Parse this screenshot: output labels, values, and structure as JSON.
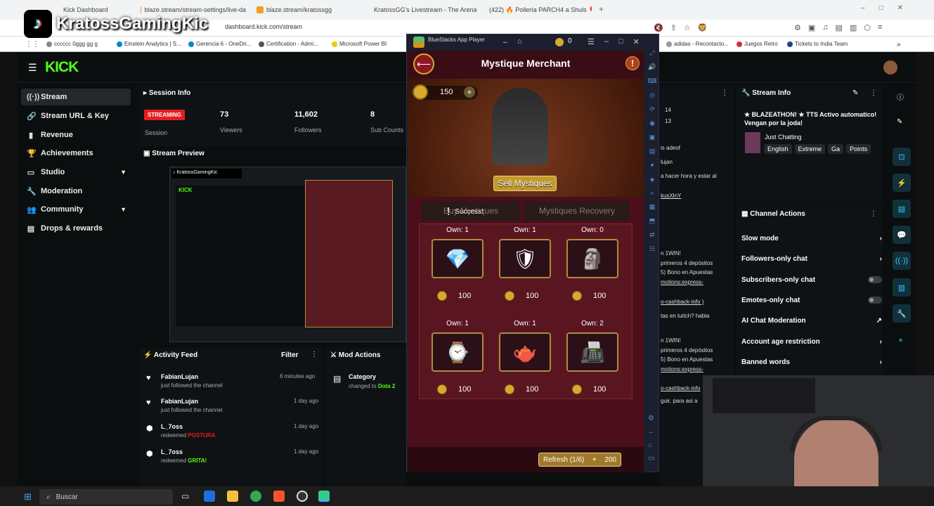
{
  "browser": {
    "tabs": [
      "Kick Dashboard",
      "blaze.stream/stream-settings/live-da",
      "blaze.stream/kratossgg",
      "KratossGG's Livestream - The Arena",
      "(422) 🔥 Pollería PARCH4 a Shuls 🎈"
    ],
    "url": "dashboard.kick.com/stream",
    "bookmarks": [
      "cccccc 0ggg gg g",
      "Einstein Analytics | S...",
      "Gerencia 6 - OneDri...",
      "Certification - Admi...",
      "Microsoft Power BI",
      "adidas - Recontacto...",
      "Juegos Retro",
      "Tickets to India Team"
    ]
  },
  "overlay": {
    "channel": "KratossGamingKic"
  },
  "sidebar": {
    "items": [
      {
        "label": "Stream",
        "icon": "broadcast-icon"
      },
      {
        "label": "Stream URL & Key",
        "icon": "link-icon"
      },
      {
        "label": "Revenue",
        "icon": "chart-icon"
      },
      {
        "label": "Achievements",
        "icon": "trophy-icon"
      },
      {
        "label": "Studio",
        "icon": "monitor-icon"
      },
      {
        "label": "Moderation",
        "icon": "wrench-icon"
      },
      {
        "label": "Community",
        "icon": "people-icon"
      },
      {
        "label": "Drops & rewards",
        "icon": "gift-icon"
      }
    ]
  },
  "session": {
    "title": "Session Info",
    "status": "STREAMING",
    "status_label": "Session",
    "viewers": "73",
    "viewers_label": "Viewers",
    "followers": "11,602",
    "followers_label": "Followers",
    "subs": "8",
    "subs_label": "Sub Counts"
  },
  "preview": {
    "title": "Stream Preview"
  },
  "activity": {
    "title": "Activity Feed",
    "filter": "Filter",
    "items": [
      {
        "name": "FabianLujan",
        "text": "just followed the channel",
        "time": "6 minutes ago"
      },
      {
        "name": "FabianLujan",
        "text": "just followed the channel",
        "time": "1 day ago"
      },
      {
        "name": "L_7oss",
        "text": "redeemed",
        "reward": "POSTURA",
        "time": "1 day ago"
      },
      {
        "name": "L_7oss",
        "text": "redeemed",
        "reward": "GRITA!",
        "time": "1 day ago"
      }
    ]
  },
  "mod_actions": {
    "title": "Mod Actions",
    "item_title": "Category",
    "item_text": "changed to",
    "item_value": "Dota 2"
  },
  "bluestacks": {
    "title": "BlueStacks App Player",
    "coins": "0"
  },
  "game": {
    "title": "Mystique Merchant",
    "gold": "150",
    "sell_button": "Sell Mystiques",
    "tab_buy": "Buy Mystiques",
    "tab_recovery": "Mystiques Recovery",
    "success": "Success!",
    "items": [
      {
        "own": "Own: 1",
        "price": "100",
        "icon": "necklace-icon",
        "glyph": "💎"
      },
      {
        "own": "Own: 1",
        "price": "100",
        "icon": "armor-icon",
        "glyph": "🛡"
      },
      {
        "own": "Own: 0",
        "price": "100",
        "icon": "bust-icon",
        "glyph": "🗿"
      },
      {
        "own": "Own: 1",
        "price": "100",
        "icon": "watch-icon",
        "glyph": "⌚"
      },
      {
        "own": "Own: 1",
        "price": "100",
        "icon": "teapot-icon",
        "glyph": "🫖"
      },
      {
        "own": "Own: 2",
        "price": "100",
        "icon": "typewriter-icon",
        "glyph": "📠"
      }
    ],
    "refresh": "Refresh (1/6)",
    "refresh_cost": "200"
  },
  "chat": {
    "lines": [
      "14",
      "13",
      "is adeof",
      "lujan",
      "a hacer hora y estar al",
      "kusXlnY",
      "n 1WIN!",
      "primeros 4 depósitos",
      "5) Bono en Apuestas",
      "motions:express-",
      "o-cashback-info )",
      "tas en tuitch? habla",
      "n 1WIN!",
      "primeros 4 depósitos",
      "5) Bono en Apuestas",
      "motions:express-",
      "o-cashback-info",
      "guir, para asi a"
    ]
  },
  "stream_info": {
    "title": "Stream Info",
    "stream_title": "★ BLAZEATHON! ★ TTS Activo automatico! Vengan por la joda!",
    "category": "Just Chatting",
    "tags": [
      "English",
      "Extreme",
      "Ga",
      "Points"
    ]
  },
  "channel_actions": {
    "title": "Channel Actions",
    "rows": [
      {
        "label": "Slow mode",
        "kind": "arrow"
      },
      {
        "label": "Followers-only chat",
        "kind": "arrow"
      },
      {
        "label": "Subscribers-only chat",
        "kind": "toggle"
      },
      {
        "label": "Emotes-only chat",
        "kind": "toggle"
      },
      {
        "label": "AI Chat Moderation",
        "kind": "link"
      },
      {
        "label": "Account age restriction",
        "kind": "arrow"
      },
      {
        "label": "Banned words",
        "kind": "arrow"
      }
    ]
  },
  "taskbar": {
    "search": "Buscar"
  },
  "colors": {
    "kick_green": "#53fc18",
    "streaming_red": "#e61e1e",
    "gold": "#d8a830"
  }
}
